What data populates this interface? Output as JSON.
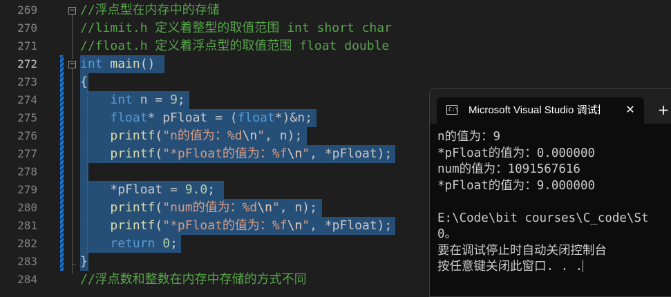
{
  "editor": {
    "lines": [
      {
        "num": "269",
        "tokens": [
          {
            "t": "//浮点型在内存中的存储",
            "c": "cmt"
          }
        ]
      },
      {
        "num": "270",
        "tokens": [
          {
            "t": "//limit.h 定义着整型的取值范围 int short char",
            "c": "cmt"
          }
        ]
      },
      {
        "num": "271",
        "tokens": [
          {
            "t": "//float.h 定义着浮点型的取值范围 float double",
            "c": "cmt"
          }
        ]
      },
      {
        "num": "272",
        "tokens": [
          {
            "t": "int",
            "c": "kw"
          },
          {
            "t": " main",
            "c": "fn"
          },
          {
            "t": "()",
            "c": "punc"
          }
        ]
      },
      {
        "num": "273",
        "tokens": [
          {
            "t": "{",
            "c": "punc"
          }
        ]
      },
      {
        "num": "274",
        "tokens": [
          {
            "t": "    ",
            "c": "punc"
          },
          {
            "t": "int",
            "c": "kw"
          },
          {
            "t": " n = ",
            "c": "ident"
          },
          {
            "t": "9",
            "c": "num"
          },
          {
            "t": ";",
            "c": "punc"
          }
        ]
      },
      {
        "num": "275",
        "tokens": [
          {
            "t": "    ",
            "c": "punc"
          },
          {
            "t": "float",
            "c": "kw"
          },
          {
            "t": "* pFloat = (",
            "c": "ident"
          },
          {
            "t": "float",
            "c": "kw"
          },
          {
            "t": "*)&n;",
            "c": "ident"
          }
        ]
      },
      {
        "num": "276",
        "tokens": [
          {
            "t": "    ",
            "c": "punc"
          },
          {
            "t": "printf",
            "c": "fn"
          },
          {
            "t": "(",
            "c": "punc"
          },
          {
            "t": "\"n的值为：%d",
            "c": "str"
          },
          {
            "t": "\\n",
            "c": "esc"
          },
          {
            "t": "\"",
            "c": "str"
          },
          {
            "t": ", n);",
            "c": "ident"
          }
        ]
      },
      {
        "num": "277",
        "tokens": [
          {
            "t": "    ",
            "c": "punc"
          },
          {
            "t": "printf",
            "c": "fn"
          },
          {
            "t": "(",
            "c": "punc"
          },
          {
            "t": "\"*pFloat的值为：%f",
            "c": "str"
          },
          {
            "t": "\\n",
            "c": "esc"
          },
          {
            "t": "\"",
            "c": "str"
          },
          {
            "t": ", *pFloat);",
            "c": "ident"
          }
        ]
      },
      {
        "num": "278",
        "tokens": []
      },
      {
        "num": "279",
        "tokens": [
          {
            "t": "    ",
            "c": "punc"
          },
          {
            "t": "*pFloat = ",
            "c": "ident"
          },
          {
            "t": "9.0",
            "c": "num"
          },
          {
            "t": ";",
            "c": "punc"
          }
        ]
      },
      {
        "num": "280",
        "tokens": [
          {
            "t": "    ",
            "c": "punc"
          },
          {
            "t": "printf",
            "c": "fn"
          },
          {
            "t": "(",
            "c": "punc"
          },
          {
            "t": "\"num的值为：%d",
            "c": "str"
          },
          {
            "t": "\\n",
            "c": "esc"
          },
          {
            "t": "\"",
            "c": "str"
          },
          {
            "t": ", n);",
            "c": "ident"
          }
        ]
      },
      {
        "num": "281",
        "tokens": [
          {
            "t": "    ",
            "c": "punc"
          },
          {
            "t": "printf",
            "c": "fn"
          },
          {
            "t": "(",
            "c": "punc"
          },
          {
            "t": "\"*pFloat的值为：%f",
            "c": "str"
          },
          {
            "t": "\\n",
            "c": "esc"
          },
          {
            "t": "\"",
            "c": "str"
          },
          {
            "t": ", *pFloat);",
            "c": "ident"
          }
        ]
      },
      {
        "num": "282",
        "tokens": [
          {
            "t": "    ",
            "c": "punc"
          },
          {
            "t": "return",
            "c": "kw"
          },
          {
            "t": " ",
            "c": "punc"
          },
          {
            "t": "0",
            "c": "num"
          },
          {
            "t": ";",
            "c": "punc"
          }
        ]
      },
      {
        "num": "283",
        "tokens": [
          {
            "t": "}",
            "c": "punc"
          }
        ]
      },
      {
        "num": "284",
        "tokens": [
          {
            "t": "//浮点数和整数在内存中存储的方式不同",
            "c": "cmt"
          }
        ]
      }
    ],
    "active_line": "272",
    "collapse_glyph": "−",
    "colors": {
      "background": "#1e1e1e",
      "selection": "#264f78",
      "comment": "#57a64a",
      "keyword": "#569cd6",
      "function": "#dcdcaa",
      "number": "#b5cea8",
      "string": "#d69d85",
      "change_bar": "#1f7ad6"
    }
  },
  "console": {
    "tab_icon": "C:\\",
    "tab_title": "Microsoft Visual Studio 调试控制台",
    "close_glyph": "✕",
    "new_tab_glyph": "+",
    "lines": [
      "n的值为：9",
      "*pFloat的值为：0.000000",
      "num的值为：1091567616",
      "*pFloat的值为：9.000000",
      "",
      "E:\\Code\\bit courses\\C_code\\St",
      "0。",
      "要在调试停止时自动关闭控制台",
      "按任意键关闭此窗口. . ."
    ],
    "icons": {
      "tab": "terminal-icon",
      "close": "close-icon",
      "new": "plus-icon"
    }
  }
}
